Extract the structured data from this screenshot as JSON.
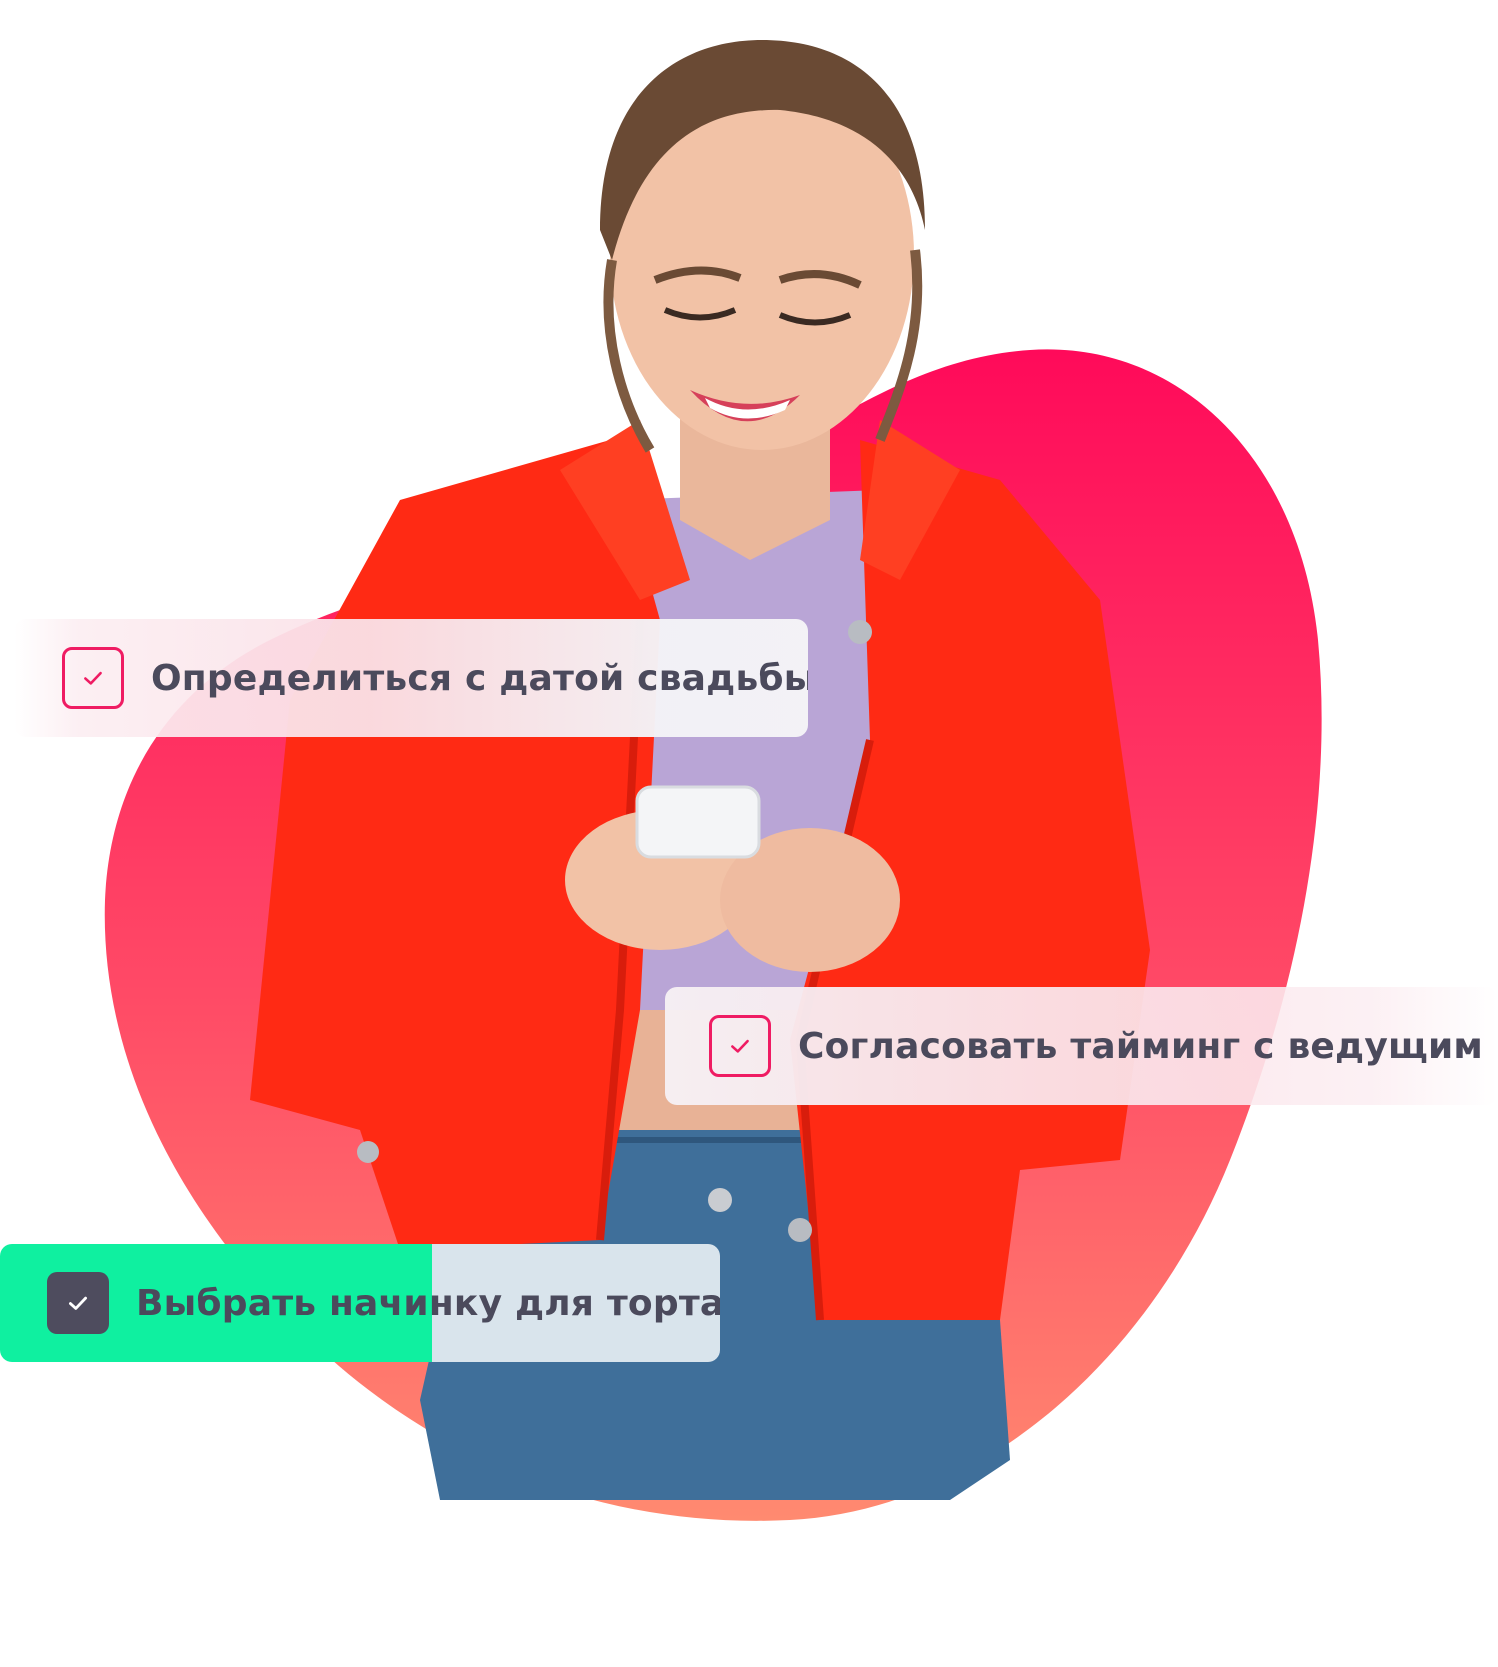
{
  "colors": {
    "blob_top": "#ff0a5a",
    "blob_bottom": "#ff7d6b",
    "jacket": "#ff2a14",
    "top_shirt": "#b9a5d6",
    "jeans": "#3f6f9a",
    "skin": "#f2c2a6",
    "hair": "#6a4a34",
    "checkbox_accent": "#ef1c63",
    "checkbox_done": "#4e4c5e",
    "done_highlight": "#0ff0a0",
    "label_text": "#4b4a5c"
  },
  "tasks": [
    {
      "label": "Определиться с датой свадьбы",
      "done": false,
      "icon": "check-icon"
    },
    {
      "label": "Согласовать тайминг с ведущим",
      "done": false,
      "icon": "check-icon"
    },
    {
      "label": "Выбрать начинку для торта",
      "done": true,
      "icon": "check-icon",
      "progress": 0.6
    }
  ]
}
